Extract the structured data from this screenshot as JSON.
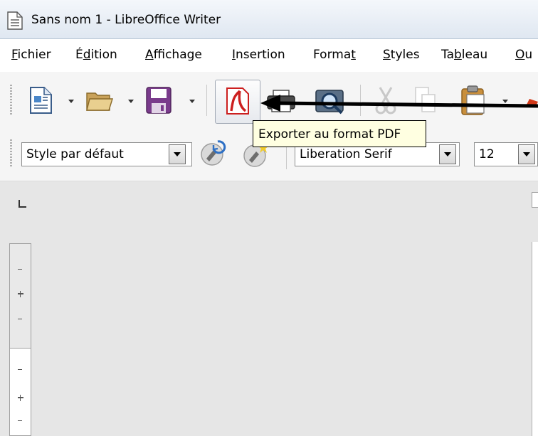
{
  "window": {
    "title": "Sans nom 1 - LibreOffice Writer"
  },
  "menu": {
    "items": [
      {
        "pre": "",
        "key": "F",
        "post": "ichier"
      },
      {
        "pre": "É",
        "key": "d",
        "post": "ition"
      },
      {
        "pre": "",
        "key": "A",
        "post": "ffichage"
      },
      {
        "pre": "",
        "key": "I",
        "post": "nsertion"
      },
      {
        "pre": "Forma",
        "key": "t",
        "post": ""
      },
      {
        "pre": "",
        "key": "S",
        "post": "tyles"
      },
      {
        "pre": "Ta",
        "key": "b",
        "post": "leau"
      },
      {
        "pre": "",
        "key": "O",
        "post": "u"
      }
    ]
  },
  "toolbar": {
    "icons": [
      "new-document-icon",
      "open-folder-icon",
      "save-icon",
      "export-pdf-icon",
      "print-icon",
      "print-preview-icon",
      "cut-icon",
      "copy-icon",
      "paste-icon"
    ]
  },
  "tooltip": {
    "text": "Exporter au format PDF"
  },
  "format_toolbar": {
    "paragraph_style": "Style par défaut",
    "font_name": "Liberation Serif",
    "font_size": "12"
  },
  "colors": {
    "pdf_red": "#cc1f1f",
    "save_purple": "#7a3b8c",
    "folder_tan": "#c9a25a",
    "tooltip_bg": "#ffffe1"
  }
}
